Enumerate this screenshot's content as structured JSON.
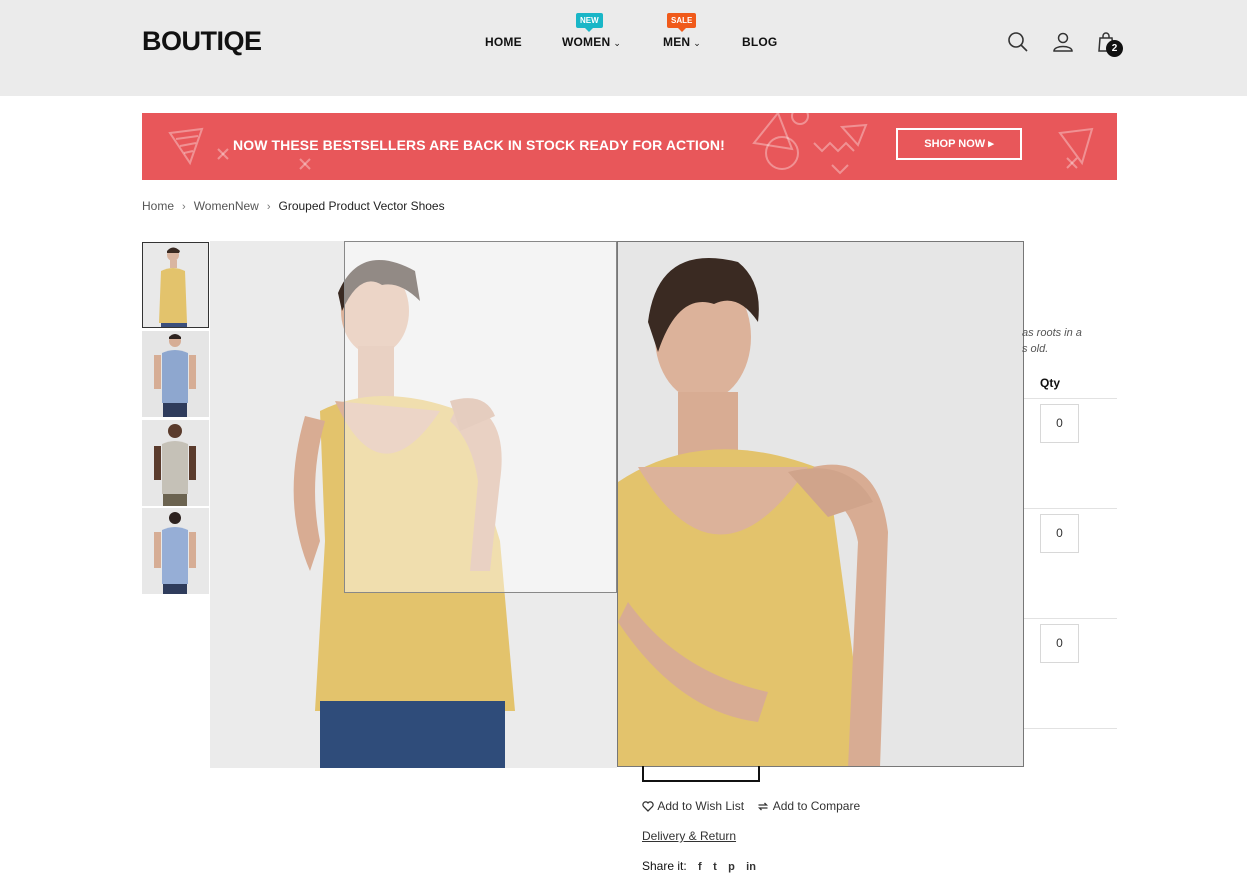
{
  "brand": {
    "logo": "BOUTIQE"
  },
  "nav": {
    "home": "HOME",
    "women": "WOMEN",
    "women_badge": "NEW",
    "men": "MEN",
    "men_badge": "SALE",
    "blog": "BLOG",
    "chevron": "⌄"
  },
  "header_icons": {
    "search": "search-icon",
    "account": "user-icon",
    "cart": "shopping-bag-icon",
    "cart_count": "2"
  },
  "promo": {
    "text": "NOW THESE BESTSELLERS ARE BACK IN STOCK READY FOR ACTION!",
    "button": "SHOP NOW ▸"
  },
  "breadcrumb": {
    "home": "Home",
    "category": "WomenNew",
    "current": "Grouped Product Vector Shoes",
    "separator": "›"
  },
  "product": {
    "description_line1": "as roots in a",
    "description_line2": "s old.",
    "qty_header": "Qty",
    "quantities": [
      "0",
      "0",
      "0"
    ],
    "wishlist": "Add to Wish List",
    "compare": "Add to Compare",
    "delivery": "Delivery & Return",
    "share_label": "Share it:",
    "share_icons": {
      "facebook": "f",
      "twitter": "t",
      "pinterest": "p",
      "linkedin": "in"
    }
  },
  "colors": {
    "header_bg": "#ebebeb",
    "promo_bg": "#e8575a",
    "badge_new": "#19b6c7",
    "badge_sale": "#f05a1a"
  }
}
